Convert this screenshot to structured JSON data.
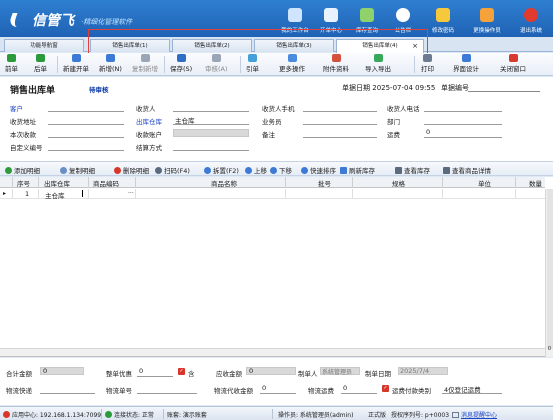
{
  "app": {
    "logo_name": "信管飞",
    "logo_sub": "·精细化管理软件"
  },
  "topnav": [
    {
      "label": "我的工作台",
      "icon": "monitor-icon",
      "color": "#cfe4ff"
    },
    {
      "label": "开单中心",
      "icon": "grid-icon",
      "color": "#e9f2ff"
    },
    {
      "label": "库存查询",
      "icon": "chart-icon",
      "color": "#8fd16a"
    },
    {
      "label": "公告栏",
      "icon": "info-icon",
      "color": "#ffffff"
    },
    {
      "label": "修改密码",
      "icon": "lock-icon",
      "color": "#f6c83b"
    },
    {
      "label": "更换操作员",
      "icon": "user-icon",
      "color": "#f5a23a"
    },
    {
      "label": "退出系统",
      "icon": "close-icon",
      "color": "#e23a2f"
    }
  ],
  "tabs": [
    {
      "label": "功能导航窗"
    },
    {
      "label": "销售出库单(1)"
    },
    {
      "label": "销售出库单(2)"
    },
    {
      "label": "销售出库单(3)"
    },
    {
      "label": "销售出库单(4)"
    }
  ],
  "tab_close": "×",
  "toolbar": [
    {
      "label": "前单",
      "icon": "arrow-left-icon",
      "color": "#2a9a3a",
      "disabled": false
    },
    {
      "label": "后单",
      "icon": "arrow-right-icon",
      "color": "#2a9a3a",
      "disabled": false
    },
    {
      "label": "新建开单",
      "icon": "new-doc-icon",
      "color": "#3d7ad6",
      "disabled": false
    },
    {
      "label": "新增(N)",
      "icon": "add-icon",
      "color": "#3d7ad6",
      "disabled": false
    },
    {
      "label": "复制新增",
      "icon": "copy-icon",
      "color": "#9aa6b6",
      "disabled": true
    },
    {
      "label": "保存(S)",
      "icon": "save-icon",
      "color": "#2f6dc6",
      "disabled": false
    },
    {
      "label": "审核(A)",
      "icon": "audit-icon",
      "color": "#9aa6b6",
      "disabled": true
    },
    {
      "label": "引单",
      "icon": "import-doc-icon",
      "color": "#46a0d8",
      "disabled": false
    },
    {
      "label": "更多操作",
      "icon": "more-icon",
      "color": "#4a8be0",
      "disabled": false
    },
    {
      "label": "附件资料",
      "icon": "attachment-icon",
      "color": "#d4503c",
      "disabled": false
    },
    {
      "label": "导入导出",
      "icon": "import-export-icon",
      "color": "#38a85a",
      "disabled": false
    },
    {
      "label": "打印",
      "icon": "print-icon",
      "color": "#6b7c92",
      "disabled": false
    },
    {
      "label": "界面设计",
      "icon": "layout-icon",
      "color": "#3d7ad6",
      "disabled": false
    },
    {
      "label": "关闭窗口",
      "icon": "close-window-icon",
      "color": "#d93a30",
      "disabled": false
    }
  ],
  "form": {
    "title": "销售出库单",
    "status": "待审核",
    "date_label": "单据日期",
    "date_value": "2025-07-04 09:55",
    "number_label": "单据编号",
    "number_value": "",
    "labels": {
      "customer": "客户",
      "receiver": "收货人",
      "receiver_mobile": "收货人手机",
      "receiver_phone": "收货人电话",
      "address": "收货地址",
      "warehouse": "出库仓库",
      "salesman": "业务员",
      "department": "部门",
      "receipt": "本次收款",
      "account": "收款账户",
      "remark": "备注",
      "freight": "运费",
      "custom_no": "自定义编号",
      "settle": "结算方式"
    },
    "values": {
      "warehouse": "主仓库",
      "freight": "0"
    }
  },
  "gridbar": [
    {
      "label": "添加明细",
      "icon": "add-row-icon",
      "color": "#2f9a3a"
    },
    {
      "label": "复制明细",
      "icon": "copy-row-icon",
      "color": "#6a8fc4"
    },
    {
      "label": "删除明细",
      "icon": "delete-row-icon",
      "color": "#d9362b"
    },
    {
      "label": "扫码(F4)",
      "icon": "scan-icon",
      "color": "#5a6b80"
    },
    {
      "label": "拆置(F2)",
      "icon": "split-icon",
      "color": "#3d7ad6"
    },
    {
      "label": "上移",
      "icon": "up-icon",
      "color": "#3d7ad6"
    },
    {
      "label": "下移",
      "icon": "down-icon",
      "color": "#3d7ad6"
    },
    {
      "label": "快速排序",
      "icon": "sort-icon",
      "color": "#3d7ad6"
    },
    {
      "label": "刷新库存",
      "icon": "refresh-icon",
      "color": "#3d7ad6"
    },
    {
      "label": "查看库存",
      "icon": "stock-icon",
      "color": "#5a6b80"
    },
    {
      "label": "查看商品详情",
      "icon": "detail-icon",
      "color": "#5a6b80"
    }
  ],
  "grid": {
    "headers": [
      "序号",
      "出库仓库",
      "商品编码",
      "商品名称",
      "批号",
      "规格",
      "单位",
      "数量"
    ],
    "rows": [
      {
        "marker": "▸",
        "seq": "1",
        "warehouse": "主仓库",
        "code": "",
        "ellipsis": "···"
      }
    ],
    "scroll_marker": "0"
  },
  "footer": {
    "total_label": "合计金额",
    "total_value": "0",
    "discount_label": "整单优惠",
    "discount_value": "0",
    "tax_check": "✓",
    "tax_label": "含",
    "receivable_label": "应收金额",
    "receivable_value": "0",
    "maker_label": "制单人",
    "maker_value": "系统管理员",
    "make_date_label": "制单日期",
    "make_date_value": "2025/7/4",
    "express_label": "物流快递",
    "express_no_label": "物流单号",
    "logistics_collect_label": "物流代收金额",
    "logistics_collect_value": "0",
    "logistics_fee_label": "物流运费",
    "logistics_fee_value": "0",
    "freight_check": "✓",
    "freight_note": "运费付款类别",
    "freight_mode": "4仅登记运费"
  },
  "statusbar": {
    "app_center": "应用中心: 192.168.1.134:7099",
    "connection": "连接状态: 正常",
    "account": "账套: 演示账套",
    "operator": "操作员: 系统管理员(admin)",
    "edition": "正式版",
    "license": "授权序列号: p+0003",
    "messages": "消息提醒中心"
  }
}
